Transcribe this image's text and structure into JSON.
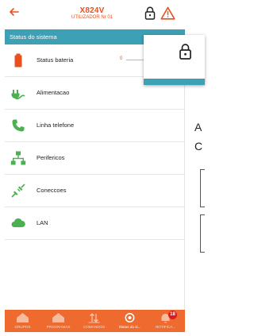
{
  "header": {
    "title": "X824V",
    "subtitle": "UTILIZADOR Nr 01",
    "back_icon": "arrow-left-icon",
    "lock_icon": "padlock-icon",
    "warning_icon": "warning-triangle-icon"
  },
  "section": {
    "label": "Status do sistema"
  },
  "menu": {
    "items": [
      {
        "label": "Status bateria",
        "icon": "battery-icon",
        "indicator": "0"
      },
      {
        "label": "Alimentacao",
        "icon": "power-plug-icon"
      },
      {
        "label": "Linha telefone",
        "icon": "phone-icon"
      },
      {
        "label": "Perifericos",
        "icon": "network-tree-icon"
      },
      {
        "label": "Coneccoes",
        "icon": "connection-plug-icon"
      },
      {
        "label": "LAN",
        "icon": "cloud-icon"
      }
    ]
  },
  "tabs": [
    {
      "label": "GRUPOS",
      "icon": "house-icon"
    },
    {
      "label": "PROGRAMAS",
      "icon": "house-icon"
    },
    {
      "label": "COMANDOS",
      "icon": "arrows-updown-icon"
    },
    {
      "label": "Status do si...",
      "icon": "target-icon",
      "active": true
    },
    {
      "label": "NOTIFICA...",
      "icon": "bell-icon",
      "badge": "18"
    }
  ],
  "popup": {
    "icon": "padlock-icon"
  },
  "background": {
    "letter1": "A",
    "letter2": "C"
  },
  "colors": {
    "accent": "#e8501e",
    "teal": "#3ea0b4",
    "green": "#4caf50",
    "tabbar": "#ee6a2e",
    "badge": "#d91d1d"
  }
}
